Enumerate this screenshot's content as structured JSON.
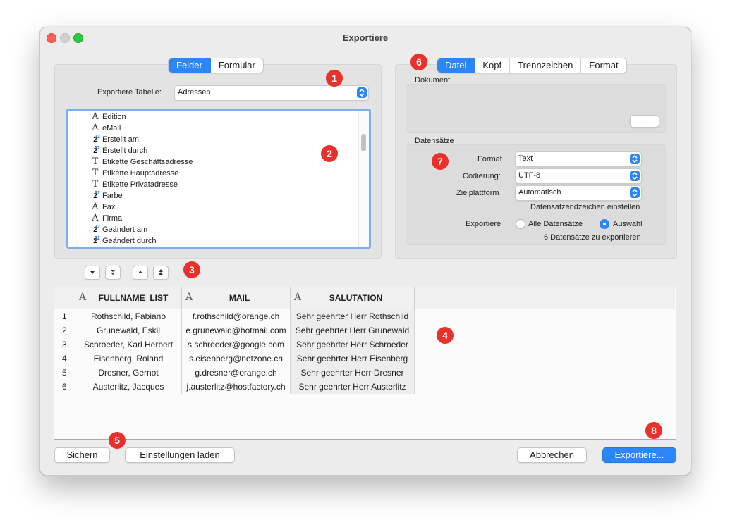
{
  "window": {
    "title": "Exportiere"
  },
  "left": {
    "tabs": [
      "Felder",
      "Formular"
    ],
    "table_label": "Exportiere Tabelle:",
    "table_value": "Adressen",
    "fields": [
      {
        "icon": "text-a",
        "label": "Edition"
      },
      {
        "icon": "text-a",
        "label": "eMail"
      },
      {
        "icon": "number",
        "label": "Erstellt am"
      },
      {
        "icon": "number",
        "label": "Erstellt durch"
      },
      {
        "icon": "text-t",
        "label": "Etikette Geschäftsadresse"
      },
      {
        "icon": "text-t",
        "label": "Etikette Hauptadresse"
      },
      {
        "icon": "text-t",
        "label": "Etikette Privatadresse"
      },
      {
        "icon": "number",
        "label": "Farbe"
      },
      {
        "icon": "text-a",
        "label": "Fax"
      },
      {
        "icon": "text-a",
        "label": "Firma"
      },
      {
        "icon": "number",
        "label": "Geändert am"
      },
      {
        "icon": "number",
        "label": "Geändert durch"
      }
    ],
    "number_icon_text": "2",
    "number_icon_sup": "32"
  },
  "right": {
    "tabs": [
      "Datei",
      "Kopf",
      "Trennzeichen",
      "Format"
    ],
    "dokument_label": "Dokument",
    "browse_label": "...",
    "datensaetze_label": "Datensätze",
    "format_label": "Format",
    "format_value": "Text",
    "codierung_label": "Codierung:",
    "codierung_value": "UTF-8",
    "zielplattform_label": "Zielplattform",
    "zielplattform_value": "Automatisch",
    "link_label": "Datensatzendzeichen einstellen",
    "exportiere_label": "Exportiere",
    "radio_all": "Alle Datensätze",
    "radio_selection": "Auswahl",
    "count_text": "6 Datensätze zu exportieren"
  },
  "badges": [
    "1",
    "2",
    "3",
    "4",
    "5",
    "6",
    "7",
    "8"
  ],
  "table": {
    "type_icon": "A",
    "columns": [
      "FULLNAME_LIST",
      "MAIL",
      "SALUTATION"
    ],
    "rows": [
      {
        "n": "1",
        "name": "Rothschild, Fabiano",
        "mail": "f.rothschild@orange.ch",
        "sal": "Sehr geehrter Herr Rothschild"
      },
      {
        "n": "2",
        "name": "Grunewald, Eskil",
        "mail": "e.grunewald@hotmail.com",
        "sal": "Sehr geehrter Herr Grunewald"
      },
      {
        "n": "3",
        "name": "Schroeder, Karl Herbert",
        "mail": "s.schroeder@google.com",
        "sal": "Sehr geehrter Herr Schroeder"
      },
      {
        "n": "4",
        "name": "Eisenberg, Roland",
        "mail": "s.eisenberg@netzone.ch",
        "sal": "Sehr geehrter Herr Eisenberg"
      },
      {
        "n": "5",
        "name": "Dresner, Gernot",
        "mail": "g.dresner@orange.ch",
        "sal": "Sehr geehrter Herr Dresner"
      },
      {
        "n": "6",
        "name": "Austerlitz, Jacques",
        "mail": "j.austerlitz@hostfactory.ch",
        "sal": "Sehr geehrter Herr Austerlitz"
      }
    ]
  },
  "footer": {
    "save_label": "Sichern",
    "load_label": "Einstellungen laden",
    "cancel_label": "Abbrechen",
    "export_label": "Exportiere..."
  },
  "colors": {
    "accent": "#2c86f6",
    "badge": "#e8312a"
  }
}
